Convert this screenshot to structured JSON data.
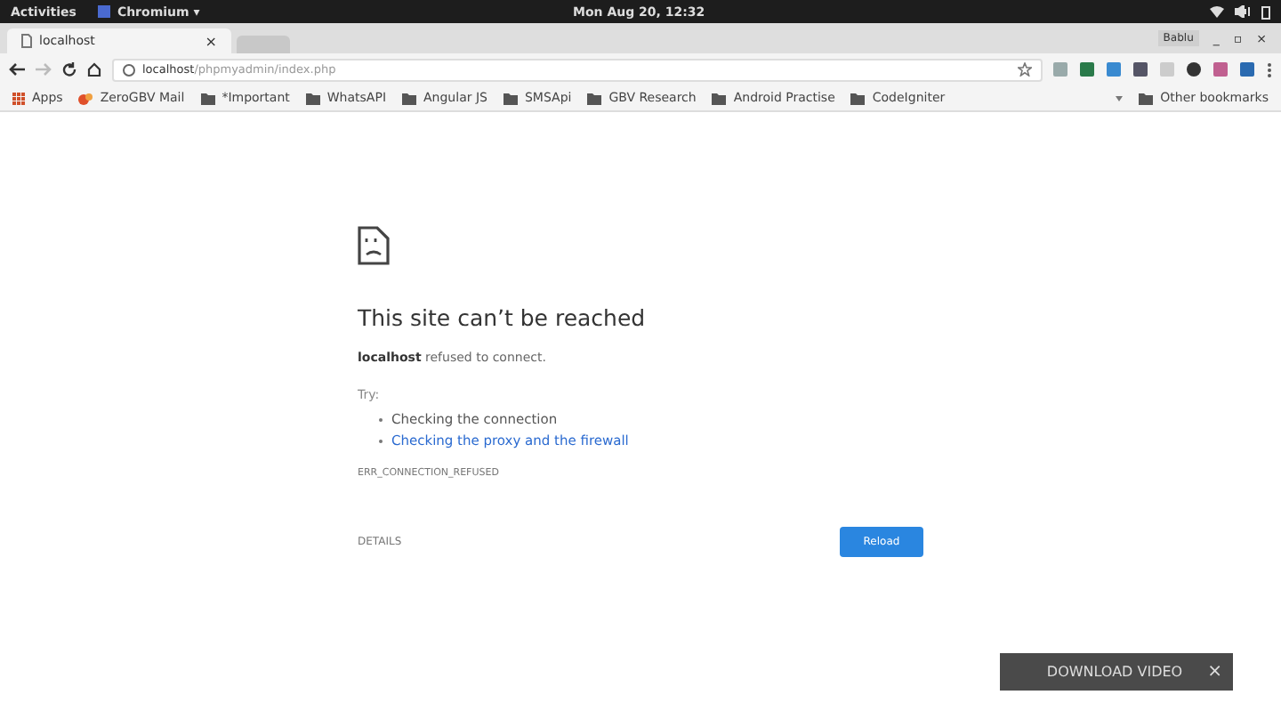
{
  "top_bar": {
    "activities": "Activities",
    "app": "Chromium ▾",
    "clock": "Mon Aug 20, 12:32"
  },
  "tabs": [
    {
      "title": "localhost",
      "close": "×",
      "selected": true
    },
    {
      "selected": false
    }
  ],
  "window": {
    "user": "Bablu",
    "controls": [
      "_",
      "▫",
      "×"
    ]
  },
  "address_bar": {
    "host": "localhost",
    "path": "/phpmyadmin/index.php"
  },
  "bookmarks": [
    {
      "kind": "apps",
      "label": "Apps"
    },
    {
      "kind": "site",
      "label": "ZeroGBV Mail"
    },
    {
      "kind": "folder",
      "label": "*Important"
    },
    {
      "kind": "folder",
      "label": "WhatsAPI"
    },
    {
      "kind": "folder",
      "label": "Angular JS"
    },
    {
      "kind": "folder",
      "label": "SMSApi"
    },
    {
      "kind": "folder",
      "label": "GBV Research"
    },
    {
      "kind": "folder",
      "label": "Android Practise"
    },
    {
      "kind": "folder",
      "label": "CodeIgniter"
    }
  ],
  "other_bookmarks": "Other bookmarks",
  "error": {
    "title": "This site can’t be reached",
    "message": "**localhost** refused to connect.",
    "try": "Try:",
    "suggestions": [
      {
        "text": "Checking the connection",
        "link": false
      },
      {
        "text": "Checking the proxy and the firewall",
        "link": true
      }
    ],
    "code": "ERR_CONNECTION_REFUSED",
    "details": "DETAILS",
    "reload": "Reload"
  },
  "download_bar": {
    "label": "DOWNLOAD VIDEO",
    "close": "×"
  }
}
